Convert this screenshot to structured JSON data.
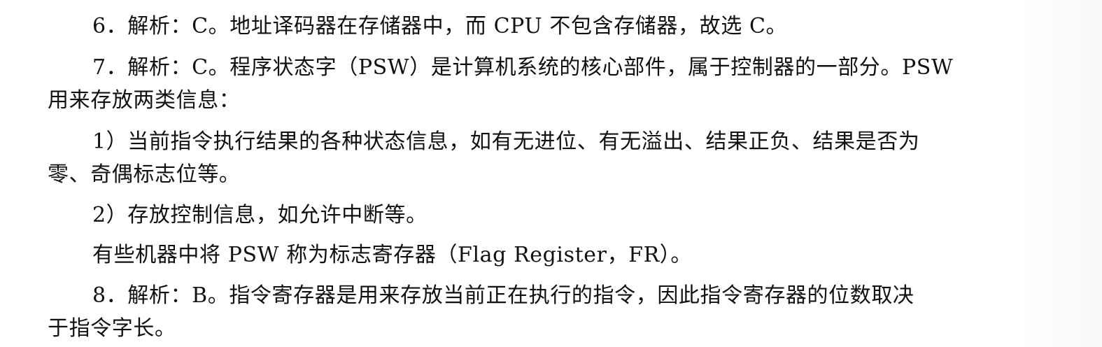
{
  "document": {
    "lines": [
      "6．解析：C。地址译码器在存储器中，而 CPU 不包含存储器，故选 C。",
      "7．解析：C。程序状态字（PSW）是计算机系统的核心部件，属于控制器的一部分。PSW",
      "用来存放两类信息：",
      "1）当前指令执行结果的各种状态信息，如有无进位、有无溢出、结果正负、结果是否为",
      "零、奇偶标志位等。",
      "2）存放控制信息，如允许中断等。",
      "有些机器中将 PSW 称为标志寄存器（Flag Register，FR）。",
      "8．解析：B。指令寄存器是用来存放当前正在执行的指令，因此指令寄存器的位数取决",
      "于指令字长。"
    ]
  }
}
